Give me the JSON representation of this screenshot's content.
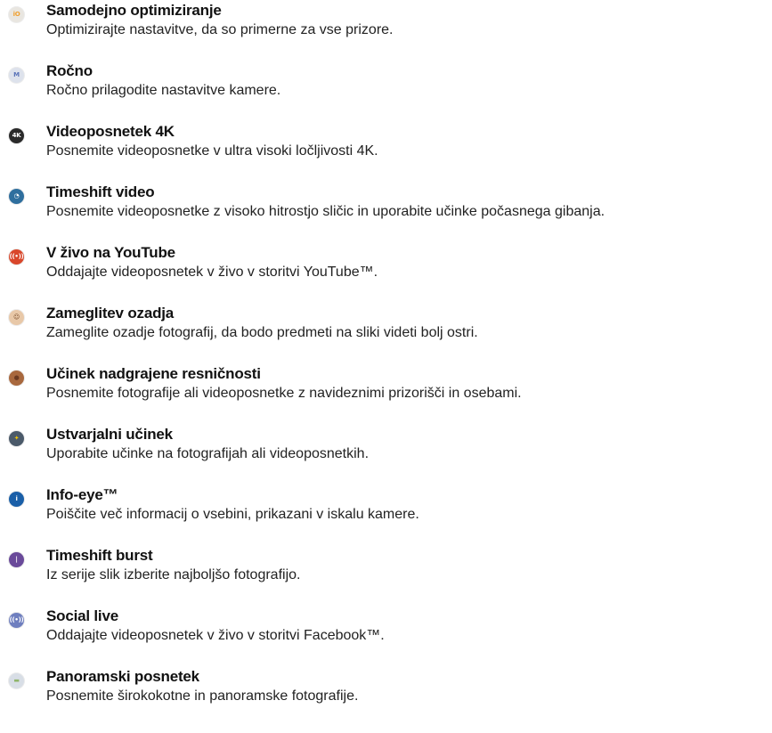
{
  "modes": [
    {
      "icon": "auto-optimize-icon",
      "glyph": "iO",
      "color": "#f0a030",
      "bg": "#e9e6e0",
      "title": "Samodejno optimiziranje",
      "description": "Optimizirajte nastavitve, da so primerne za vse prizore."
    },
    {
      "icon": "manual-mode-icon",
      "glyph": "M",
      "color": "#5a73b8",
      "bg": "#dde2ec",
      "title": "Ročno",
      "description": "Ročno prilagodite nastavitve kamere."
    },
    {
      "icon": "video-4k-icon",
      "glyph": "4K",
      "color": "#ffffff",
      "bg": "#2a2a2a",
      "title": "Videoposnetek 4K",
      "description": "Posnemite videoposnetke v ultra visoki ločljivosti 4K."
    },
    {
      "icon": "timeshift-video-icon",
      "glyph": "◔",
      "color": "#ffffff",
      "bg": "#2f6f9e",
      "title": "Timeshift video",
      "description": "Posnemite videoposnetke z visoko hitrostjo sličic in uporabite učinke počasnega gibanja."
    },
    {
      "icon": "youtube-live-icon",
      "glyph": "((•))",
      "color": "#ffffff",
      "bg": "#d9472b",
      "title": "V živo na YouTube",
      "description": "Oddajajte videoposnetek v živo v storitvi YouTube™."
    },
    {
      "icon": "background-defocus-icon",
      "glyph": "☺",
      "color": "#7a4e2c",
      "bg": "#e8c8a8",
      "title": "Zameglitev ozadja",
      "description": "Zameglite ozadje fotografij, da bodo predmeti na sliki videti bolj ostri."
    },
    {
      "icon": "ar-effect-icon",
      "glyph": "●",
      "color": "#6b3a22",
      "bg": "#a8683e",
      "title": "Učinek nadgrajene resničnosti",
      "description": "Posnemite fotografije ali videoposnetke z navideznimi prizorišči in osebami."
    },
    {
      "icon": "creative-effect-icon",
      "glyph": "✦",
      "color": "#f2c400",
      "bg": "#4b5a6a",
      "title": "Ustvarjalni učinek",
      "description": "Uporabite učinke na fotografijah ali videoposnetkih."
    },
    {
      "icon": "info-eye-icon",
      "glyph": "i",
      "color": "#ffffff",
      "bg": "#1a5fa8",
      "title": "Info-eye™",
      "description": "Poiščite več informacij o vsebini, prikazani v iskalu kamere."
    },
    {
      "icon": "timeshift-burst-icon",
      "glyph": "|",
      "color": "#ffffff",
      "bg": "#6a4a9a",
      "title": "Timeshift burst",
      "description": "Iz serije slik izberite najboljšo fotografijo."
    },
    {
      "icon": "social-live-icon",
      "glyph": "((•))",
      "color": "#ffffff",
      "bg": "#6f7fbf",
      "title": "Social live",
      "description": "Oddajajte videoposnetek v živo v storitvi Facebook™."
    },
    {
      "icon": "panorama-icon",
      "glyph": "▬",
      "color": "#8fb56a",
      "bg": "#d8dee6",
      "title": "Panoramski posnetek",
      "description": "Posnemite širokokotne in panoramske fotografije."
    }
  ]
}
